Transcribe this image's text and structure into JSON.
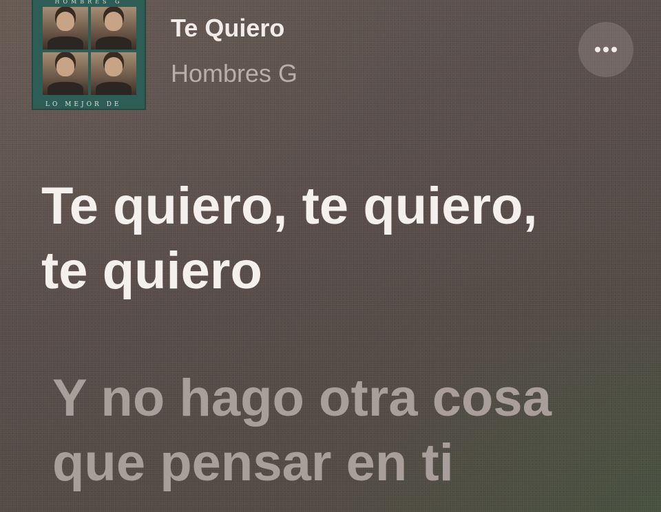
{
  "now_playing": {
    "title": "Te Quiero",
    "artist": "Hombres G",
    "album_art": {
      "band_text": "HOMBRES G",
      "footer_text": "LO MEJOR DE"
    },
    "more_icon": "ellipsis-icon"
  },
  "lyrics": {
    "current": {
      "lines": [
        "Te quiero, te quiero,",
        "te quiero"
      ]
    },
    "next": {
      "lines": [
        "Y no hago otra cosa",
        "que pensar en ti"
      ]
    }
  },
  "colors": {
    "background": "#574c49",
    "current_lyric": "#f3f0ee",
    "upcoming_lyric": "#a89f9b",
    "artist_text": "#b9aea9"
  }
}
